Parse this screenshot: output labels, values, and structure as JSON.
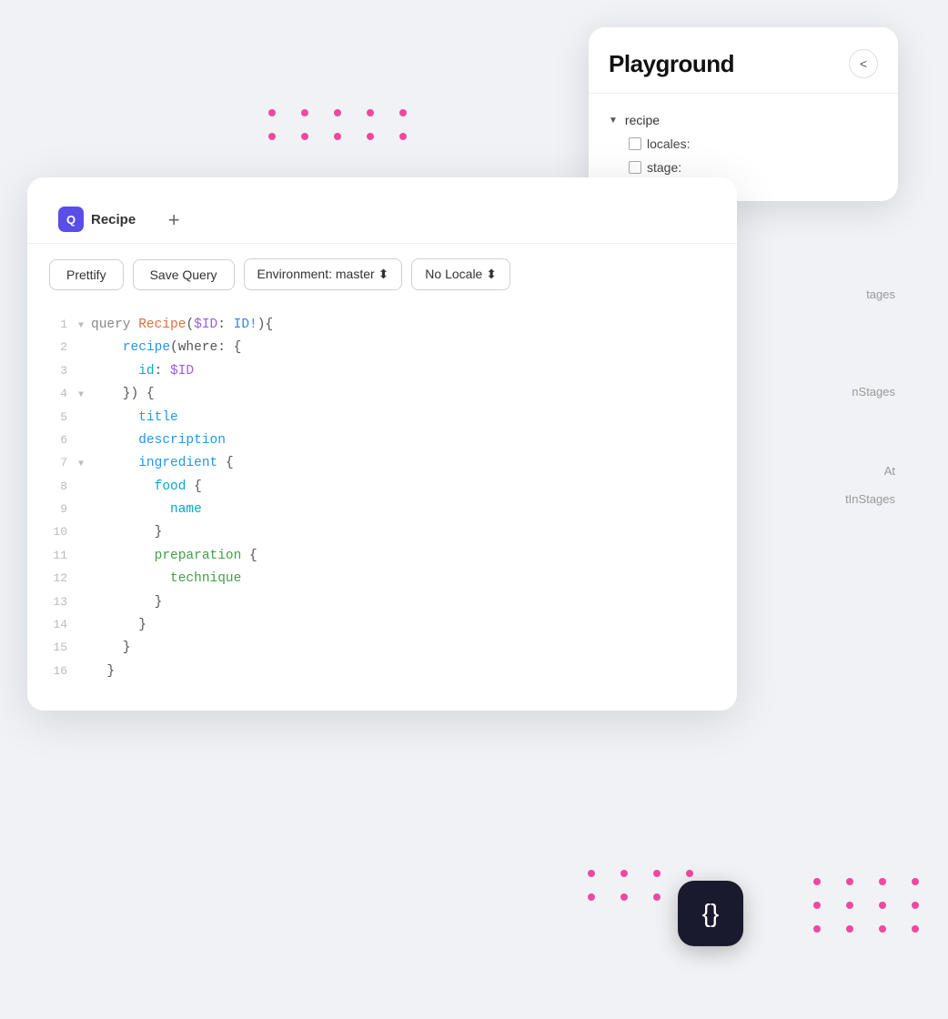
{
  "playground": {
    "title": "Playground",
    "close_btn": "<",
    "tree": {
      "root": "recipe",
      "children": [
        {
          "label": "locales:",
          "checked": false
        },
        {
          "label": "stage:",
          "checked": false
        }
      ]
    }
  },
  "right_labels": [
    "tages",
    "nStages",
    "At",
    "tInStages"
  ],
  "editor": {
    "tab_label": "Recipe",
    "tab_icon": "Q",
    "add_tab_label": "+",
    "toolbar": {
      "prettify_label": "Prettify",
      "save_query_label": "Save Query",
      "environment_label": "Environment: master ⬍",
      "locale_label": "No Locale ⬍"
    },
    "code_lines": [
      {
        "num": "1",
        "fold": "▼",
        "content": "query ",
        "rest": [
          {
            "t": "fn-name",
            "v": "Recipe"
          },
          {
            "t": "brace",
            "v": "("
          },
          {
            "t": "param",
            "v": "$ID"
          },
          {
            "t": "brace",
            "v": ": "
          },
          {
            "t": "type",
            "v": "ID!"
          },
          {
            "t": "brace",
            "v": ")){"
          }
        ]
      },
      {
        "num": "2",
        "fold": "",
        "content": "    recipe(where: {",
        "rest": []
      },
      {
        "num": "3",
        "fold": "",
        "content": "      id: $ID",
        "rest": []
      },
      {
        "num": "4",
        "fold": "▼",
        "content": "    }) {",
        "rest": []
      },
      {
        "num": "5",
        "fold": "",
        "content": "      title",
        "rest": []
      },
      {
        "num": "6",
        "fold": "",
        "content": "      description",
        "rest": []
      },
      {
        "num": "7",
        "fold": "▼",
        "content": "      ingredient {",
        "rest": []
      },
      {
        "num": "8",
        "fold": "",
        "content": "        food {",
        "rest": []
      },
      {
        "num": "9",
        "fold": "",
        "content": "          name",
        "rest": []
      },
      {
        "num": "10",
        "fold": "",
        "content": "        }",
        "rest": []
      },
      {
        "num": "11",
        "fold": "",
        "content": "        preparation {",
        "rest": []
      },
      {
        "num": "12",
        "fold": "",
        "content": "          technique",
        "rest": []
      },
      {
        "num": "13",
        "fold": "",
        "content": "        }",
        "rest": []
      },
      {
        "num": "14",
        "fold": "",
        "content": "      }",
        "rest": []
      },
      {
        "num": "15",
        "fold": "",
        "content": "    }",
        "rest": []
      },
      {
        "num": "16",
        "fold": "",
        "content": "  }",
        "rest": []
      }
    ]
  },
  "floating_icon": {
    "symbol": "{}"
  },
  "dots": {
    "count": 10
  }
}
